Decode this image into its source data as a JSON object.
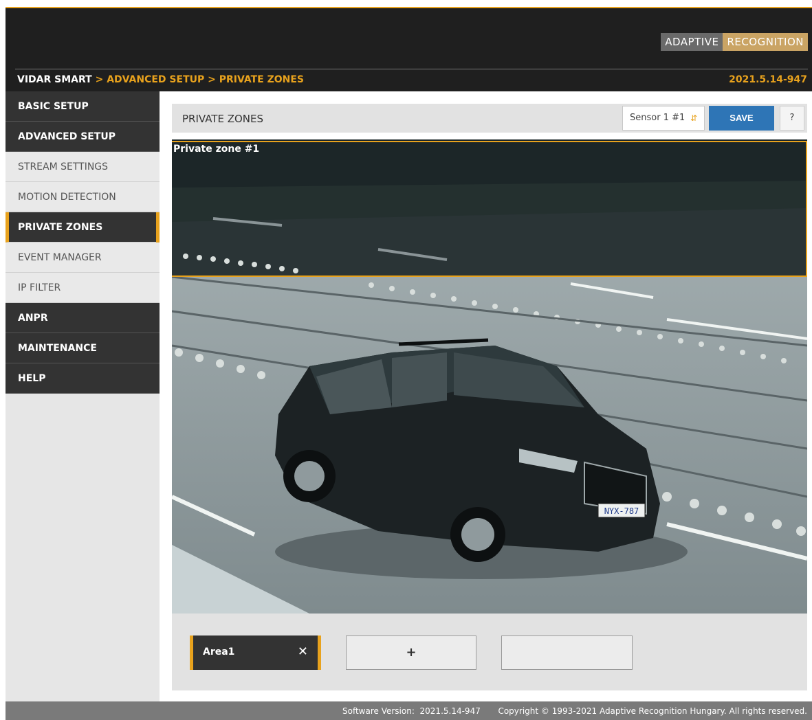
{
  "colors": {
    "accent": "#e8a21d",
    "header_bg": "#1f1f1f",
    "save_blue": "#2e75b6"
  },
  "brand": {
    "part1": "ADAPTIVE",
    "part2": "RECOGNITION"
  },
  "breadcrumb": {
    "root": "VIDAR SMART",
    "path": " > ADVANCED SETUP > PRIVATE ZONES"
  },
  "version_top": "2021.5.14-947",
  "sidebar": {
    "items": [
      {
        "label": "BASIC SETUP"
      },
      {
        "label": "ADVANCED SETUP"
      },
      {
        "label": "STREAM SETTINGS"
      },
      {
        "label": "MOTION DETECTION"
      },
      {
        "label": "PRIVATE ZONES"
      },
      {
        "label": "EVENT MANAGER"
      },
      {
        "label": "IP FILTER"
      },
      {
        "label": "ANPR"
      },
      {
        "label": "MAINTENANCE"
      },
      {
        "label": "HELP"
      }
    ]
  },
  "panel": {
    "title": "PRIVATE ZONES",
    "sensor_selected": "Sensor 1 #1",
    "save_label": "SAVE",
    "help_label": "?"
  },
  "camera": {
    "zone_label": "Private zone #1",
    "plate": "NYX-787"
  },
  "areas": {
    "items": [
      {
        "label": "Area1",
        "close": "✕"
      }
    ],
    "add_label": "+"
  },
  "footer": {
    "version_label": "Software Version:",
    "version_value": "2021.5.14-947",
    "copyright": "Copyright © 1993-2021 Adaptive Recognition Hungary. All rights reserved."
  }
}
